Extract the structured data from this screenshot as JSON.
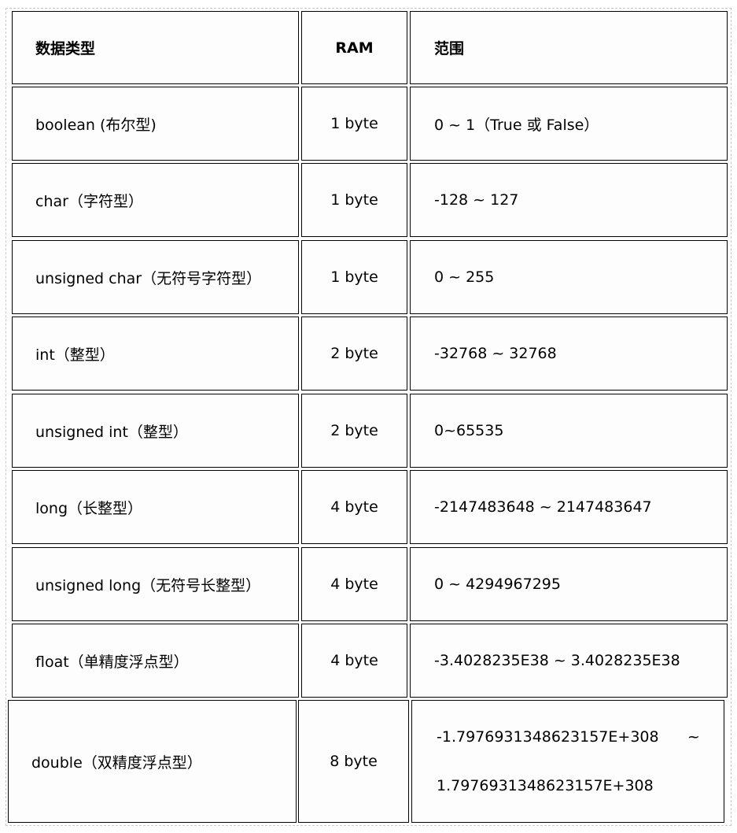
{
  "table": {
    "headers": [
      "数据类型",
      "RAM",
      "范围"
    ],
    "rows": [
      {
        "type": "boolean (布尔型)",
        "ram": "1 byte",
        "range": "0  ~  1（True  或 False）"
      },
      {
        "type": "char（字符型）",
        "ram": "1 byte",
        "range": "-128 ~ 127"
      },
      {
        "type": "unsigned char（无符号字符型）",
        "ram": "1 byte",
        "range": "0 ~ 255"
      },
      {
        "type": "int（整型）",
        "ram": "2 byte",
        "range": "-32768 ~ 32768"
      },
      {
        "type": "unsigned int（整型）",
        "ram": "2 byte",
        "range": "0~65535"
      },
      {
        "type": "long（长整型）",
        "ram": "4 byte",
        "range": "-2147483648 ~ 2147483647"
      },
      {
        "type": "unsigned long（无符号长整型）",
        "ram": "4 byte",
        "range": "0 ~ 4294967295"
      },
      {
        "type": "float（单精度浮点型）",
        "ram": "4 byte",
        "range": "-3.4028235E38  ~  3.4028235E38"
      },
      {
        "type": "double（双精度浮点型）",
        "ram": "8 byte",
        "range_line1": "-1.7976931348623157E+308      ~",
        "range_line2": "1.7976931348623157E+308"
      }
    ]
  }
}
